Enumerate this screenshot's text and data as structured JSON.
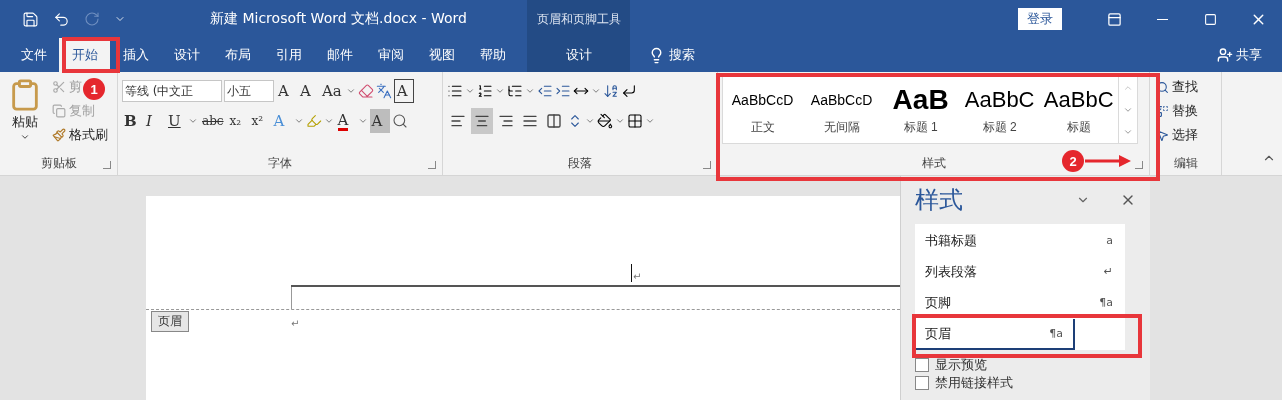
{
  "title_bar": {
    "title": "新建 Microsoft Word 文档.docx  -  Word",
    "context_group": "页眉和页脚工具",
    "sign_in": "登录"
  },
  "tabs": [
    {
      "label": "文件",
      "selected": false
    },
    {
      "label": "开始",
      "selected": true
    },
    {
      "label": "插入",
      "selected": false
    },
    {
      "label": "设计",
      "selected": false
    },
    {
      "label": "布局",
      "selected": false
    },
    {
      "label": "引用",
      "selected": false
    },
    {
      "label": "邮件",
      "selected": false
    },
    {
      "label": "审阅",
      "selected": false
    },
    {
      "label": "视图",
      "selected": false
    },
    {
      "label": "帮助",
      "selected": false
    }
  ],
  "context_tab": {
    "label": "设计"
  },
  "search": {
    "label": "搜索"
  },
  "share": {
    "label": "共享"
  },
  "clipboard": {
    "label": "剪贴板",
    "paste": "粘贴",
    "items": [
      {
        "kind": "cut",
        "label": "剪",
        "disabled": true
      },
      {
        "kind": "copy",
        "label": "复制",
        "disabled": true
      },
      {
        "kind": "painter",
        "label": "格式刷",
        "disabled": false
      }
    ]
  },
  "font": {
    "label": "字体",
    "font_name": "等线 (中文正",
    "font_size": "小五",
    "row1": [
      {
        "kind": "grow",
        "label": "A"
      },
      {
        "kind": "shrink",
        "label": "A"
      },
      {
        "kind": "case",
        "label": "Aa"
      },
      {
        "kind": "clear"
      },
      {
        "kind": "phonetic"
      },
      {
        "kind": "border",
        "label": "A"
      }
    ],
    "row2": [
      {
        "kind": "bold",
        "label": "B"
      },
      {
        "kind": "italic",
        "label": "I"
      },
      {
        "kind": "underline",
        "label": "U"
      },
      {
        "kind": "strike",
        "label": "abc"
      },
      {
        "kind": "sub",
        "label": "x₂"
      },
      {
        "kind": "sup",
        "label": "x²"
      },
      {
        "kind": "effect",
        "label": "A"
      },
      {
        "kind": "highlight"
      },
      {
        "kind": "color",
        "label": "A"
      },
      {
        "kind": "shade",
        "label": "A"
      },
      {
        "kind": "enclose"
      }
    ]
  },
  "paragraph": {
    "label": "段落",
    "alignments": [
      {
        "kind": "left",
        "selected": false
      },
      {
        "kind": "center",
        "selected": true
      },
      {
        "kind": "right",
        "selected": false
      },
      {
        "kind": "justify",
        "selected": false
      },
      {
        "kind": "distributed",
        "selected": false
      }
    ]
  },
  "styles": {
    "label": "样式",
    "gallery": [
      {
        "kind": "body",
        "sample": "AaBbCcD",
        "label": "正文"
      },
      {
        "kind": "body",
        "sample": "AaBbCcD",
        "label": "无间隔"
      },
      {
        "kind": "heading1",
        "sample": "AaB",
        "label": "标题 1"
      },
      {
        "kind": "heading2",
        "sample": "AaBbC",
        "label": "标题 2"
      },
      {
        "kind": "title",
        "sample": "AaBbC",
        "label": "标题"
      }
    ]
  },
  "editing": {
    "label": "编辑",
    "items": [
      {
        "kind": "find",
        "label": "查找"
      },
      {
        "kind": "replace",
        "label": "替换"
      },
      {
        "kind": "select",
        "label": "选择"
      }
    ]
  },
  "document": {
    "header_tag": "页眉",
    "marks": [
      "↵",
      "↵"
    ]
  },
  "styles_pane": {
    "title": "样式",
    "items": [
      {
        "name": "书籍标题",
        "mark": "a",
        "selected": false
      },
      {
        "name": "列表段落",
        "mark": "↵",
        "selected": false
      },
      {
        "name": "页脚",
        "mark": "¶a",
        "selected": false
      },
      {
        "name": "页眉",
        "mark": "¶a",
        "selected": true
      }
    ],
    "options": [
      {
        "label": "显示预览",
        "checked": false
      },
      {
        "label": "禁用链接样式",
        "checked": false
      }
    ]
  },
  "annotations": [
    {
      "number": "1"
    },
    {
      "number": "2"
    }
  ]
}
